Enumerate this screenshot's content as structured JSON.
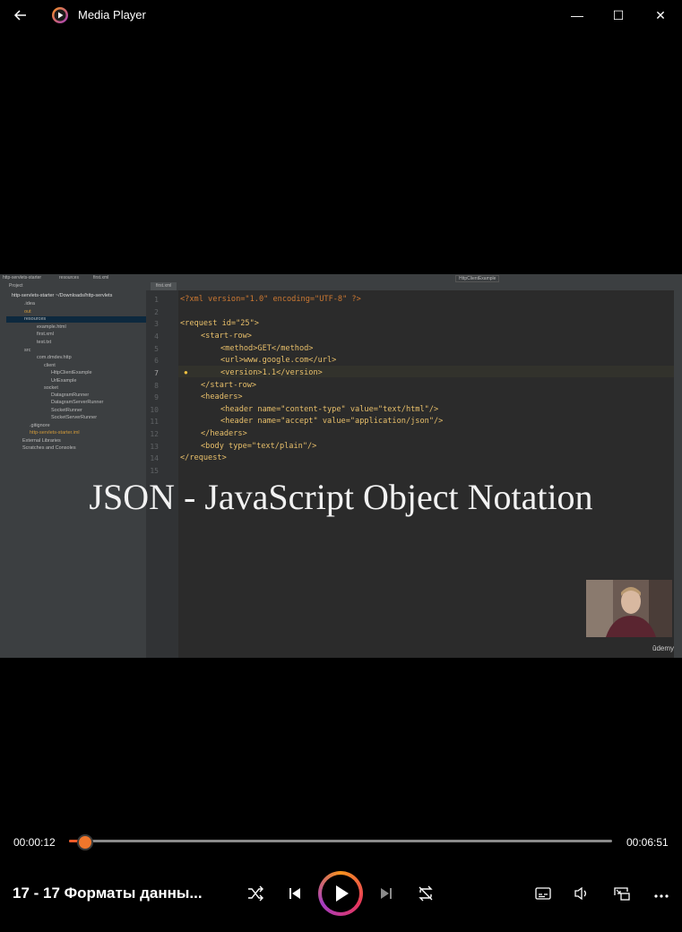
{
  "window": {
    "title": "Media Player",
    "back_icon": "arrow-left-icon",
    "app_icon": "media-player-icon",
    "minimize": "—",
    "maximize": "☐",
    "close": "✕"
  },
  "video": {
    "overlay_text": "JSON - JavaScript Object Notation",
    "watermark": "ûdemy",
    "ide": {
      "breadcrumb": [
        "http-servlets-starter",
        "resources",
        "first.xml"
      ],
      "run_config": "HttpClientExample",
      "open_tab": "first.xml",
      "project_label": "Project",
      "tree": [
        "http-servlets-starter ~/Downloads/http-servlets",
        ".idea",
        "out",
        "resources",
        "example.html",
        "first.xml",
        "test.txt",
        "src",
        "com.dmdev.http",
        "client",
        "HttpClientExample",
        "UrlExample",
        "socket",
        "DatagramRunner",
        "DatagramServerRunner",
        "SocketRunner",
        "SocketServerRunner",
        ".gitignore",
        "http-servlets-starter.iml",
        "External Libraries",
        "Scratches and Consoles"
      ],
      "line_numbers": [
        "1",
        "2",
        "3",
        "4",
        "5",
        "6",
        "7",
        "8",
        "9",
        "10",
        "11",
        "12",
        "13",
        "14",
        "15"
      ],
      "code": {
        "l1": "<?xml version=\"1.0\" encoding=\"UTF-8\" ?>",
        "l3": "<request id=\"25\">",
        "l4": "<start-row>",
        "l5": "<method>GET</method>",
        "l6": "<url>www.google.com</url>",
        "l7": "<version>1.1</version>",
        "l8": "</start-row>",
        "l9": "<headers>",
        "l10": "<header name=\"content-type\" value=\"text/html\"/>",
        "l11": "<header name=\"accept\" value=\"application/json\"/>",
        "l12": "</headers>",
        "l13": "<body type=\"text/plain\"/>",
        "l14": "</request>"
      }
    }
  },
  "controls": {
    "current_time": "00:00:12",
    "total_time": "00:06:51",
    "progress_fraction": 0.03,
    "media_title": "17 - 17 Форматы данны...",
    "shuffle_icon": "shuffle-icon",
    "previous_icon": "previous-icon",
    "play_icon": "play-icon",
    "next_icon": "next-icon",
    "repeat_icon": "repeat-icon",
    "subtitles_icon": "subtitles-icon",
    "volume_icon": "volume-icon",
    "miniplayer_icon": "miniplayer-icon",
    "more_icon": "more-icon"
  }
}
